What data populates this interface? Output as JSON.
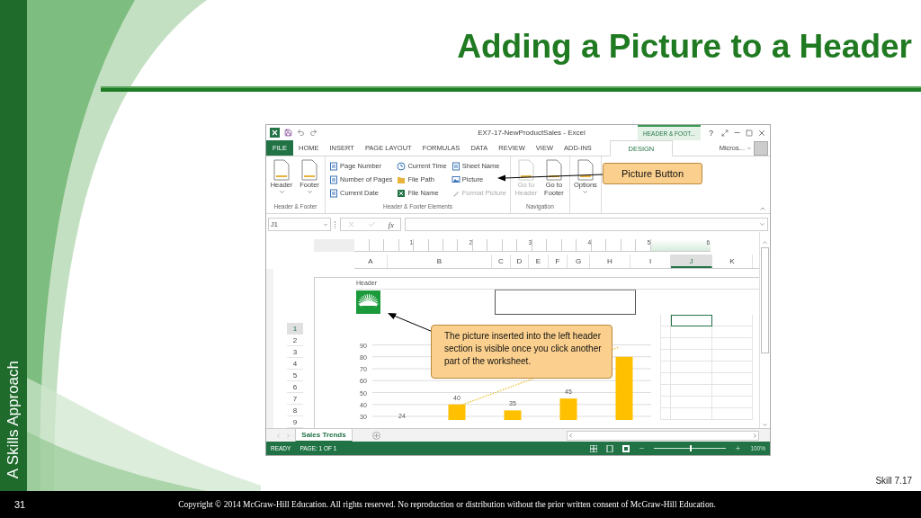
{
  "slide": {
    "title": "Adding a Picture to a Header",
    "side_label": "A Skills Approach",
    "skill": "Skill 7.17",
    "page_number": "31",
    "copyright": "Copyright © 2014 McGraw-Hill Education. All rights reserved. No reproduction or distribution without the prior written consent of McGraw-Hill Education."
  },
  "window": {
    "title": "EX7-17-NewProductSales - Excel",
    "context_tab": "HEADER & FOOT...",
    "help": "?"
  },
  "tabs": [
    {
      "label": "FILE",
      "kind": "file",
      "selected": false
    },
    {
      "label": "HOME",
      "kind": "plain",
      "selected": false
    },
    {
      "label": "INSERT",
      "kind": "plain",
      "selected": false
    },
    {
      "label": "PAGE LAYOUT",
      "kind": "plain",
      "selected": false
    },
    {
      "label": "FORMULAS",
      "kind": "plain",
      "selected": false
    },
    {
      "label": "DATA",
      "kind": "plain",
      "selected": false
    },
    {
      "label": "REVIEW",
      "kind": "plain",
      "selected": false
    },
    {
      "label": "VIEW",
      "kind": "plain",
      "selected": false
    },
    {
      "label": "ADD-INS",
      "kind": "plain",
      "selected": false
    },
    {
      "label": "DESIGN",
      "kind": "context",
      "selected": true
    }
  ],
  "account": "Micros...",
  "ribbon": {
    "groups": [
      {
        "kind": "large",
        "label": "Header & Footer",
        "buttons": [
          {
            "label": "Header",
            "dropdown": true,
            "disabled": false
          },
          {
            "label": "Footer",
            "dropdown": true,
            "disabled": false
          }
        ]
      },
      {
        "kind": "small",
        "label": "Header & Footer Elements",
        "columns": [
          [
            {
              "label": "Page Number",
              "disabled": false
            },
            {
              "label": "Number of Pages",
              "disabled": false
            },
            {
              "label": "Current Date",
              "disabled": false
            }
          ],
          [
            {
              "label": "Current Time",
              "disabled": false
            },
            {
              "label": "File Path",
              "disabled": false
            },
            {
              "label": "File Name",
              "disabled": false
            }
          ],
          [
            {
              "label": "Sheet Name",
              "disabled": false
            },
            {
              "label": "Picture",
              "disabled": false
            },
            {
              "label": "Format Picture",
              "disabled": true
            }
          ]
        ]
      },
      {
        "kind": "large",
        "label": "Navigation",
        "buttons": [
          {
            "label": "Go to Header",
            "dropdown": false,
            "disabled": true
          },
          {
            "label": "Go to Footer",
            "dropdown": false,
            "disabled": false
          }
        ]
      },
      {
        "kind": "large",
        "buttons": [
          {
            "label": "Options",
            "dropdown": true,
            "disabled": false
          }
        ]
      }
    ]
  },
  "formula_bar": {
    "name_box": "J1",
    "function_label": "fx"
  },
  "ruler": [
    "1",
    "2",
    "3",
    "4",
    "5",
    "6"
  ],
  "columns": [
    {
      "label": "A",
      "selected": false
    },
    {
      "label": "B",
      "selected": false
    },
    {
      "label": "C",
      "selected": false
    },
    {
      "label": "D",
      "selected": false
    },
    {
      "label": "E",
      "selected": false
    },
    {
      "label": "F",
      "selected": false
    },
    {
      "label": "G",
      "selected": false
    },
    {
      "label": "H",
      "selected": false
    },
    {
      "label": "I",
      "selected": false
    },
    {
      "label": "J",
      "selected": true
    },
    {
      "label": "K",
      "selected": false
    }
  ],
  "header": {
    "label": "Header"
  },
  "rows": [
    {
      "label": "1",
      "selected": true
    },
    {
      "label": "2",
      "selected": false
    },
    {
      "label": "3",
      "selected": false
    },
    {
      "label": "4",
      "selected": false
    },
    {
      "label": "5",
      "selected": false
    },
    {
      "label": "6",
      "selected": false
    },
    {
      "label": "7",
      "selected": false
    },
    {
      "label": "8",
      "selected": false
    },
    {
      "label": "9",
      "selected": false
    }
  ],
  "chart_data": {
    "type": "bar",
    "values": [
      null,
      40,
      35,
      45,
      80
    ],
    "ylim": [
      30,
      90
    ],
    "yticks": [
      30,
      40,
      50,
      60,
      70,
      80,
      90
    ],
    "value_labels": [
      "24",
      "40",
      "35",
      "45",
      null
    ],
    "grid": true
  },
  "sheet_tabs": [
    {
      "label": "Sales Trends",
      "selected": true
    }
  ],
  "status_bar": {
    "mode": "READY",
    "page": "PAGE: 1 OF 1",
    "zoom": "100%",
    "zoom_slider": {
      "level": 0.5
    }
  },
  "callouts": [
    {
      "text": "Picture Button"
    },
    {
      "text": "The picture inserted into the left header section is visible once you click another part of the worksheet."
    }
  ]
}
